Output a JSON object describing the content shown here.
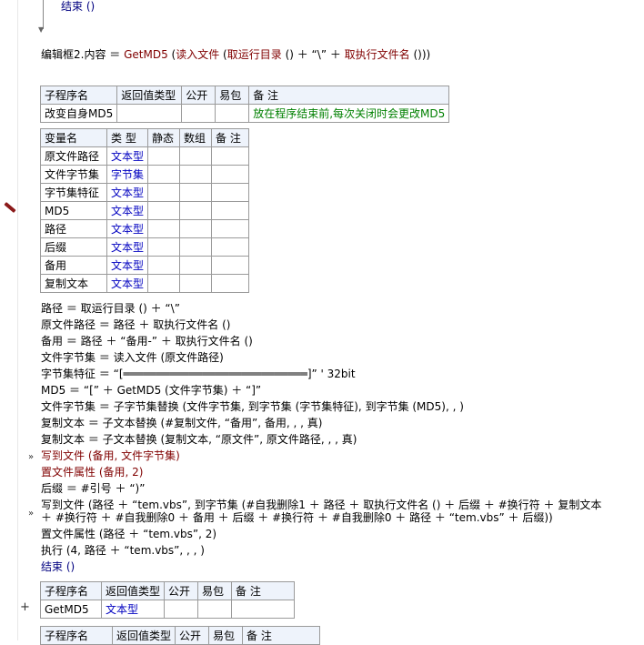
{
  "top_code": {
    "end_label": "结束 ()"
  },
  "line_edit": {
    "lhs": "编辑框2.内容 ＝ ",
    "fn1": "GetMD5",
    "paren1": " (",
    "fn2": "读入文件",
    "paren2": " (",
    "fn3": "取运行目录",
    "rest1": " () ＋ “\\” ＋ ",
    "fn4": "取执行文件名",
    "rest2": " ()))"
  },
  "sub_table1": {
    "headers": [
      "子程序名",
      "返回值类型",
      "公开",
      "易包",
      "备 注"
    ],
    "name": "改变自身MD5",
    "remark": "放在程序结束前,每次关闭时会更改MD5"
  },
  "var_table": {
    "headers": [
      "变量名",
      "类 型",
      "静态",
      "数组",
      "备 注"
    ],
    "rows": [
      {
        "name": "原文件路径",
        "type": "文本型"
      },
      {
        "name": "文件字节集",
        "type": "字节集"
      },
      {
        "name": "字节集特征",
        "type": "文本型"
      },
      {
        "name": "MD5",
        "type": "文本型"
      },
      {
        "name": "路径",
        "type": "文本型"
      },
      {
        "name": "后缀",
        "type": "文本型"
      },
      {
        "name": "备用",
        "type": "文本型"
      },
      {
        "name": "复制文本",
        "type": "文本型"
      }
    ]
  },
  "code_lines": [
    "路径 ＝ 取运行目录 () ＋ “\\”",
    "原文件路径 ＝ 路径 ＋ 取执行文件名 ()",
    "备用 ＝ 路径 ＋ “备用-” ＋ 取执行文件名 ()",
    "文件字节集 ＝ 读入文件 (原文件路径)",
    "字节集特征 ＝ “[════════════════════════════]”  ' 32bit",
    "MD5 ＝ “[” ＋ GetMD5 (文件字节集) ＋ “]”",
    "文件字节集 ＝ 子字节集替换 (文件字节集, 到字节集 (字节集特征), 到字节集 (MD5), , )",
    "复制文本 ＝ 子文本替换 (#复制文件, “备用”, 备用, , , 真)",
    "复制文本 ＝ 子文本替换 (复制文本, “原文件”, 原文件路径, , , 真)",
    "写到文件 (备用, 文件字节集)",
    "置文件属性 (备用, 2)",
    "后缀 ＝ #引号 ＋ “)”",
    "写到文件 (路径 ＋ “tem.vbs”, 到字节集 (#自我删除1 ＋ 路径 ＋ 取执行文件名 () ＋ 后缀 ＋ #换行符 ＋ 复制文本",
    " ＋ #换行符 ＋ #自我删除0 ＋ 备用 ＋ 后缀 ＋ #换行符 ＋ #自我删除0 ＋ 路径 ＋ “tem.vbs” ＋ 后缀))",
    "置文件属性 (路径 ＋ “tem.vbs”, 2)",
    "执行 (4, 路径 ＋ “tem.vbs”, , , )",
    "结束 ()"
  ],
  "sub_table2": {
    "headers": [
      "子程序名",
      "返回值类型",
      "公开",
      "易包",
      "备 注"
    ],
    "name": "GetMD5",
    "type": "文本型"
  },
  "sub_table3": {
    "headers": [
      "子程序名",
      "返回值类型",
      "公开",
      "易包",
      "备 注"
    ]
  },
  "markers": {
    "arrow": "»",
    "plus": "+"
  }
}
